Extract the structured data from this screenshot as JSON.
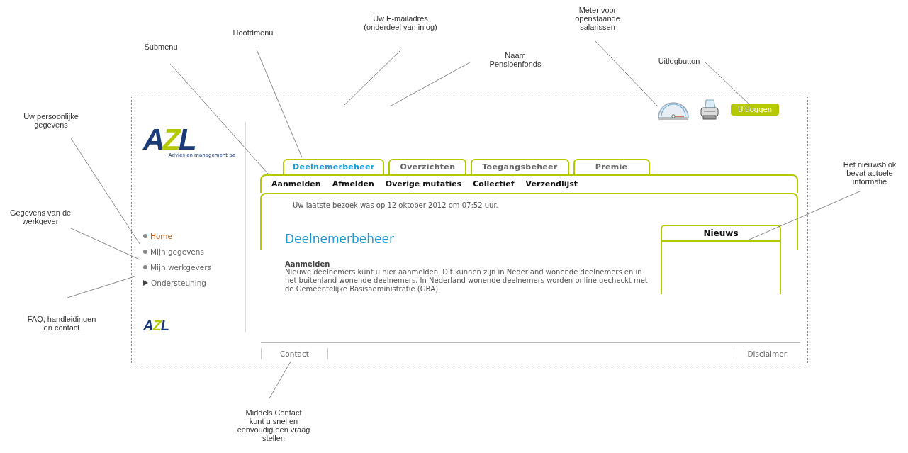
{
  "annotations": [
    {
      "text": "Uw E-mailadres\n(onderdeel van inlog)"
    },
    {
      "text": "Meter voor\nopenstaande\nsalarissen"
    },
    {
      "text": "Hoofdmenu"
    },
    {
      "text": "Submenu"
    },
    {
      "text": "Naam\nPensioenfonds"
    },
    {
      "text": "Uitlogbutton"
    },
    {
      "text": "Uw persoonlijke\ngegevens"
    },
    {
      "text": "Het nieuwsblok\nbevat actuele\ninformatie"
    },
    {
      "text": "Gegevens van de\nwerkgever"
    },
    {
      "text": "FAQ, handleidingen\nen contact"
    },
    {
      "text": "Middels Contact\nkunt u snel en\neenvoudig een vraag\nstellen"
    }
  ],
  "header": {
    "logout_button": "Uitloggen"
  },
  "logo": {
    "text": "AZL",
    "tagline": "Advies en management pe"
  },
  "tabs": [
    {
      "label": "Deelnemerbeheer",
      "selected": true
    },
    {
      "label": "Overzichten",
      "selected": false
    },
    {
      "label": "Toegangsbeheer",
      "selected": false
    },
    {
      "label": "Premie",
      "selected": false
    }
  ],
  "submenu": [
    "Aanmelden",
    "Afmelden",
    "Overige mutaties",
    "Collectief",
    "Verzendlijst"
  ],
  "last_visit": "Uw laatste bezoek was op 12 oktober 2012 om 07:52 uur.",
  "sidebar": {
    "items": [
      {
        "label": "Home",
        "kind": "bullet",
        "selected": true
      },
      {
        "label": "Mijn gegevens",
        "kind": "bullet",
        "selected": false
      },
      {
        "label": "Mijn werkgevers",
        "kind": "bullet",
        "selected": false
      },
      {
        "label": "Ondersteuning",
        "kind": "arrow",
        "selected": false
      }
    ]
  },
  "content": {
    "title": "Deelnemerbeheer",
    "section_title": "Aanmelden",
    "body": "Nieuwe deelnemers kunt u hier aanmelden. Dit kunnen zijn in Nederland wonende deelnemers en in het buitenland wonende deelnemers. In Nederland wonende deelnemers worden online gecheckt met de Gemeentelijke Basisadministratie (GBA)."
  },
  "news": {
    "title": "Nieuws"
  },
  "footer_logo": {
    "text": "AZL"
  },
  "footer": {
    "links": [
      "Contact",
      "Disclaimer"
    ]
  }
}
